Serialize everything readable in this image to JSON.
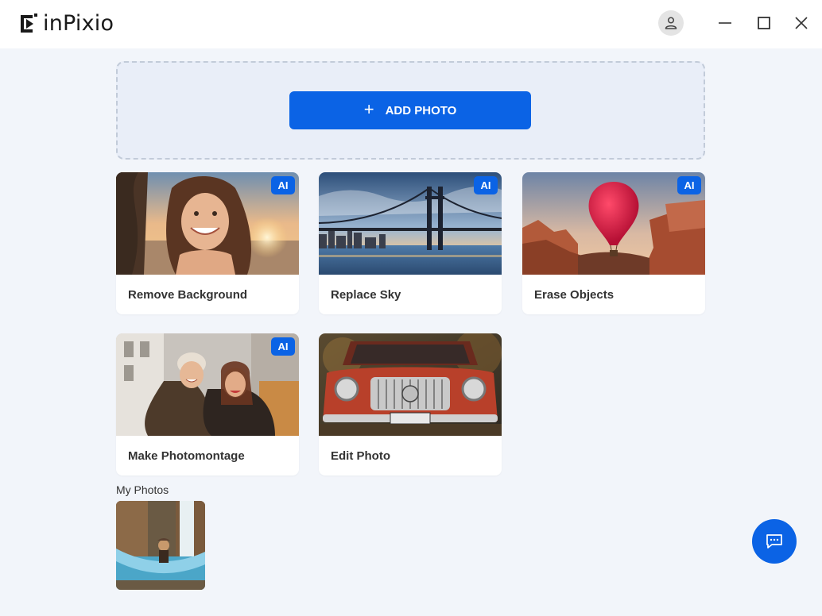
{
  "app": {
    "name": "inPixio"
  },
  "header": {
    "user_icon": "user-icon",
    "window_controls": [
      "minimize-icon",
      "maximize-icon",
      "close-icon"
    ]
  },
  "dropzone": {
    "add_label": "ADD PHOTO",
    "add_icon": "plus-icon"
  },
  "badge": "AI",
  "tools": [
    {
      "label": "Remove Background",
      "ai": true,
      "image": "woman-portrait-beach-sunset"
    },
    {
      "label": "Replace Sky",
      "ai": true,
      "image": "bridge-city-skyline"
    },
    {
      "label": "Erase Objects",
      "ai": true,
      "image": "hot-air-balloon-canyon"
    },
    {
      "label": "Make Photomontage",
      "ai": true,
      "image": "two-friends-selfie"
    },
    {
      "label": "Edit Photo",
      "ai": false,
      "image": "red-vintage-car"
    }
  ],
  "my_photos": {
    "label": "My Photos",
    "items": [
      {
        "image": "person-hammock-waterfall"
      }
    ]
  },
  "chat": {
    "icon": "chat-icon"
  },
  "colors": {
    "accent": "#0b63e5",
    "background": "#f2f5fa",
    "header": "#ffffff"
  }
}
